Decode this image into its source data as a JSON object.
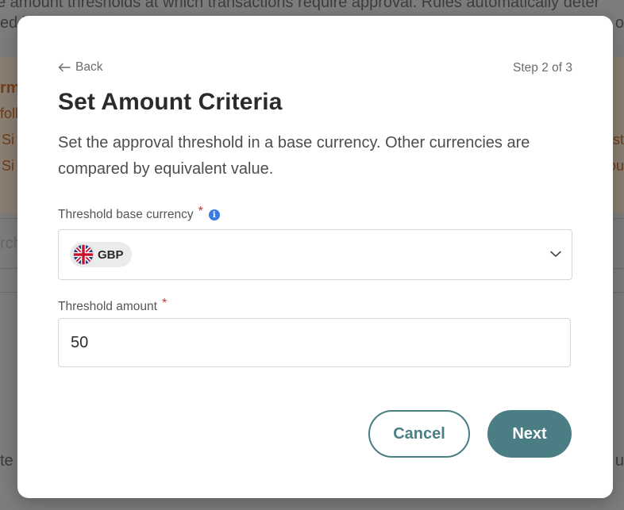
{
  "background": {
    "line1": "e amount thresholds at which transactions require approval. Rules automatically deter",
    "line2_left": "ed b",
    "line2_right": "o",
    "band_left_1": "rm",
    "band_left_2": "foll",
    "band_left_3": "Si",
    "band_left_4": "Si",
    "band_right_3": "st",
    "band_right_4": "ou",
    "search_fragment": "rch",
    "bottom_left": "te",
    "bottom_right": "u"
  },
  "modal": {
    "back_label": "Back",
    "step_label": "Step 2 of 3",
    "title": "Set Amount Criteria",
    "description": "Set the approval threshold in a base currency. Other currencies are compared by equivalent value.",
    "currency_field": {
      "label": "Threshold base currency",
      "required_mark": "*",
      "info_glyph": "i",
      "selected_code": "GBP",
      "flag_icon": "uk-flag-icon"
    },
    "amount_field": {
      "label": "Threshold amount",
      "required_mark": "*",
      "value": "50"
    },
    "cancel_label": "Cancel",
    "next_label": "Next"
  },
  "colors": {
    "accent": "#4b7d84",
    "required": "#c23a3a",
    "info": "#3b7be0"
  }
}
